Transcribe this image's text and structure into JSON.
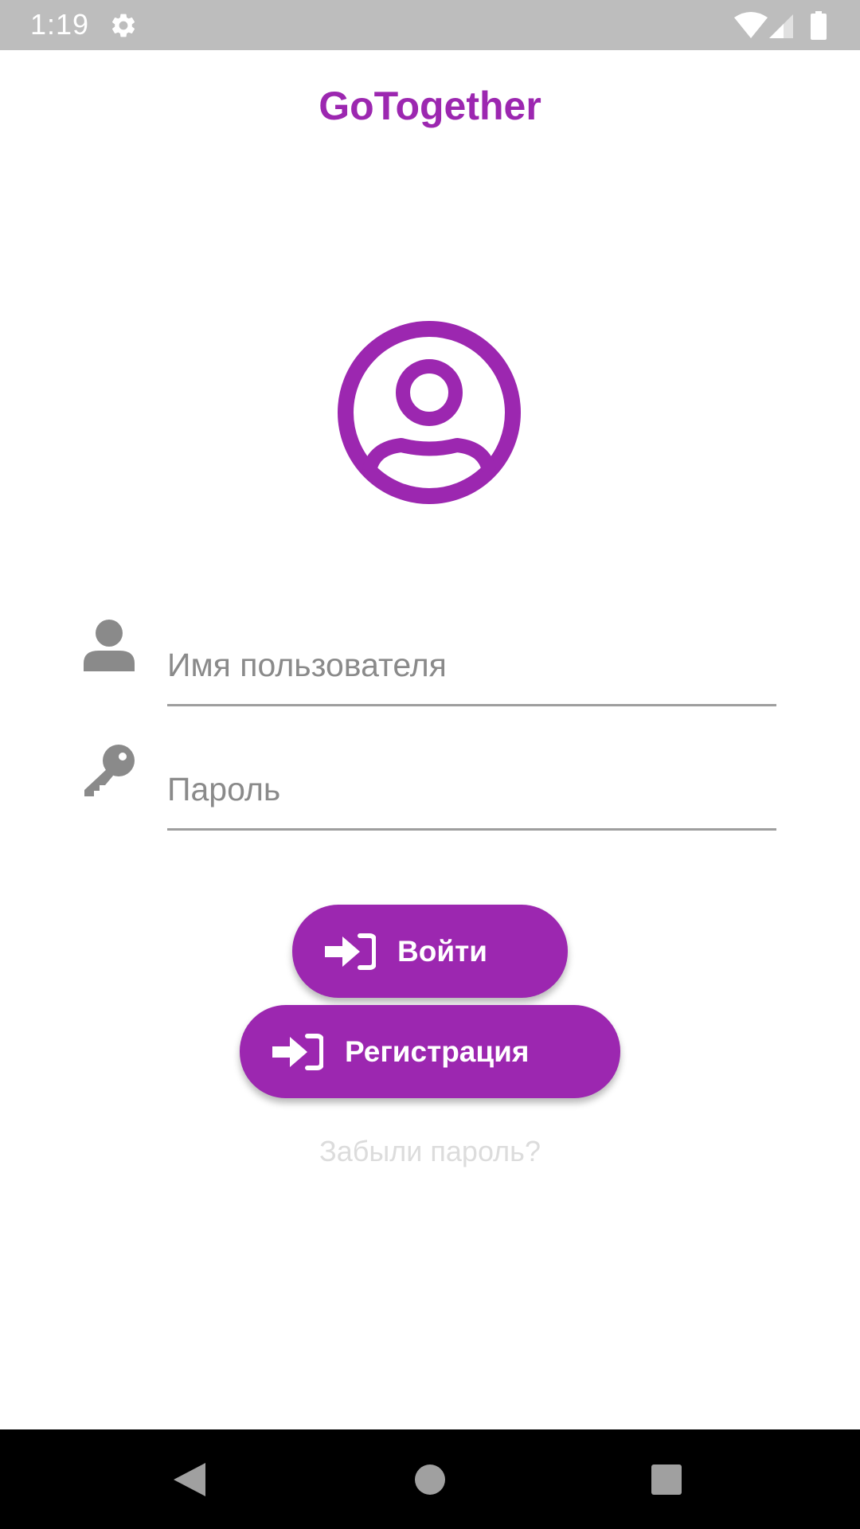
{
  "status_bar": {
    "time": "1:19",
    "background": "#bdbdbd"
  },
  "app": {
    "title": "GoTogether",
    "accent_color": "#9c27b0"
  },
  "avatar": {
    "icon": "account-circle-icon"
  },
  "form": {
    "username": {
      "icon": "person-icon",
      "placeholder": "Имя пользователя",
      "value": ""
    },
    "password": {
      "icon": "key-icon",
      "placeholder": "Пароль",
      "value": ""
    }
  },
  "buttons": {
    "login": {
      "icon": "login-icon",
      "label": "Войти"
    },
    "register": {
      "icon": "login-icon",
      "label": "Регистрация"
    }
  },
  "forgot_password": "Забыли пароль?",
  "nav_bar": {
    "back_icon": "back-triangle-icon",
    "home_icon": "home-circle-icon",
    "recents_icon": "recents-square-icon"
  }
}
